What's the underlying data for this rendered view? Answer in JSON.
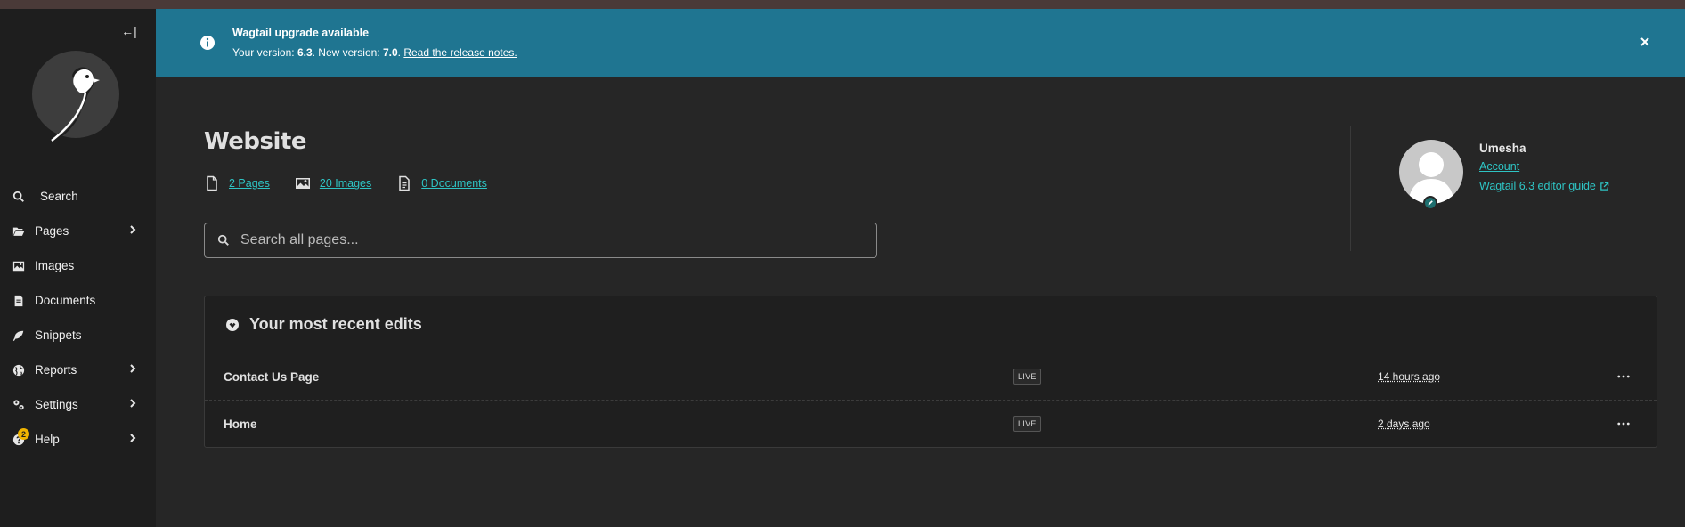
{
  "sidebar": {
    "collapse_label": "←|",
    "items": [
      {
        "label": "Search",
        "icon": "search-icon"
      },
      {
        "label": "Pages",
        "icon": "folder-open-icon",
        "has_submenu": true
      },
      {
        "label": "Images",
        "icon": "image-icon"
      },
      {
        "label": "Documents",
        "icon": "document-icon"
      },
      {
        "label": "Snippets",
        "icon": "snippet-icon"
      },
      {
        "label": "Reports",
        "icon": "globe-icon",
        "has_submenu": true
      },
      {
        "label": "Settings",
        "icon": "cogs-icon",
        "has_submenu": true
      },
      {
        "label": "Help",
        "icon": "help-icon",
        "has_submenu": true,
        "badge": "2"
      }
    ]
  },
  "banner": {
    "title": "Wagtail upgrade available",
    "text_prefix": "Your version: ",
    "current_version": "6.3",
    "text_middle": ". New version: ",
    "new_version": "7.0",
    "text_suffix": ". ",
    "link": "Read the release notes.",
    "color": "#1f7591"
  },
  "main": {
    "title": "Website",
    "stats": [
      {
        "label": "2 Pages",
        "icon": "page-icon"
      },
      {
        "label": "20 Images",
        "icon": "image-icon"
      },
      {
        "label": "0 Documents",
        "icon": "document-icon"
      }
    ],
    "search_placeholder": "Search all pages..."
  },
  "profile": {
    "name": "Umesha",
    "account_link": "Account",
    "guide_link": "Wagtail 6.3 editor guide"
  },
  "recent_edits": {
    "title": "Your most recent edits",
    "rows": [
      {
        "name": "Contact Us Page",
        "status": "LIVE",
        "time": "14 hours ago"
      },
      {
        "name": "Home",
        "status": "LIVE",
        "time": "2 days ago"
      }
    ]
  },
  "colors": {
    "accent": "#2ec4c4",
    "sidebar_bg": "#1e1e1e",
    "main_bg": "#262626"
  }
}
